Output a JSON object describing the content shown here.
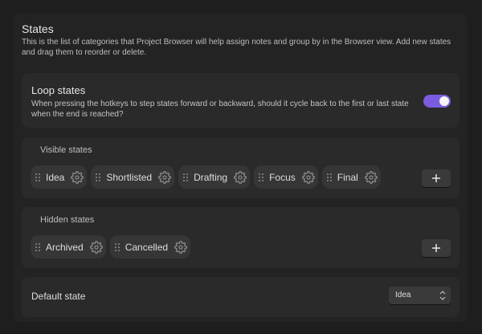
{
  "settings": {
    "title": "States",
    "description": "This is the list of categories that Project Browser will help assign notes and group by in the Browser view. Add new states and drag them to reorder or delete."
  },
  "loop": {
    "title": "Loop states",
    "description": "When pressing the hotkeys to step states forward or backward, should it cycle back to the first or last state when the end is reached?",
    "enabled": true,
    "accent_color": "#7b5ce0"
  },
  "visible_states": {
    "title": "Visible states",
    "items": [
      {
        "label": "Idea"
      },
      {
        "label": "Shortlisted"
      },
      {
        "label": "Drafting"
      },
      {
        "label": "Focus"
      },
      {
        "label": "Final"
      }
    ],
    "add_icon": "plus-icon"
  },
  "hidden_states": {
    "title": "Hidden states",
    "items": [
      {
        "label": "Archived"
      },
      {
        "label": "Cancelled"
      }
    ],
    "add_icon": "plus-icon"
  },
  "default_state": {
    "label": "Default state",
    "selected": "Idea"
  }
}
